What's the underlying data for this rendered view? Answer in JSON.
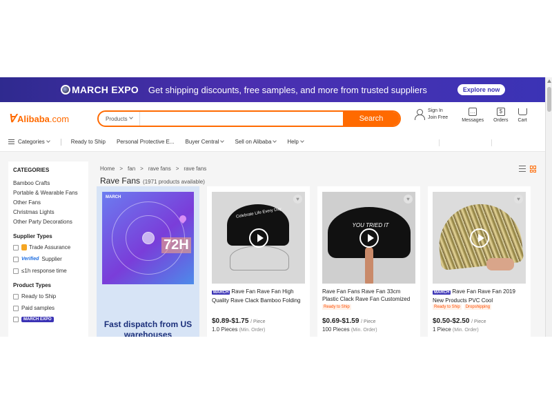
{
  "banner": {
    "logo_text": "MARCH EXPO",
    "message": "Get shipping discounts, free samples, and more from trusted suppliers",
    "cta": "Explore now"
  },
  "header": {
    "brand_name": "Alibaba",
    "brand_domain": ".com",
    "search": {
      "category": "Products",
      "value": "",
      "button": "Search"
    },
    "signin": {
      "line1": "Sign In",
      "line2": "Join Free"
    },
    "items": [
      {
        "label": "Messages",
        "icon": "message-icon"
      },
      {
        "label": "Orders",
        "icon": "orders-icon"
      },
      {
        "label": "Cart",
        "icon": "cart-icon"
      }
    ]
  },
  "nav": {
    "categories": "Categories",
    "items": [
      "Ready to Ship",
      "Personal Protective E...",
      "Buyer Central",
      "Sell on Alibaba",
      "Help"
    ]
  },
  "sidebar": {
    "categories_title": "CATEGORIES",
    "categories": [
      "Bamboo Crafts",
      "Portable & Wearable Fans",
      "Other Fans",
      "Christmas Lights",
      "Other Party Decorations"
    ],
    "supplier_types_title": "Supplier Types",
    "supplier_types": [
      "Trade Assurance",
      "Supplier",
      "≤1h response time"
    ],
    "verified_label": "Verified",
    "product_types_title": "Product Types",
    "product_types": [
      "Ready to Ship",
      "Paid samples"
    ],
    "march_expo_badge": "MARCH EXPO"
  },
  "breadcrumb": [
    "Home",
    ">",
    "fan",
    ">",
    "rave fans",
    ">",
    "rave fans"
  ],
  "results": {
    "title": "Rave Fans",
    "count": "(1971 products available)"
  },
  "promo": {
    "badge": "MARCH",
    "hours": "72H",
    "text": "Fast dispatch from US warehouses"
  },
  "products": [
    {
      "badge": "MARCH",
      "title": "Rave Fan Rave Fan High Quality Rave Clack Bamboo Folding",
      "tags": [],
      "price": "$0.89-$1.75",
      "unit": "/ Piece",
      "moq": "1.0 Pieces",
      "moq_note": "(Min. Order)",
      "image_text": "Celebrate Life Every Day"
    },
    {
      "badge": "",
      "title": "Rave Fan Fans Rave Fan 33cm Plastic Clack Rave Fan Customized",
      "tags": [
        "Ready to Ship"
      ],
      "price": "$0.69-$1.59",
      "unit": "/ Piece",
      "moq": "100 Pieces",
      "moq_note": "(Min. Order)",
      "image_text": "YOU TRIED IT"
    },
    {
      "badge": "MARCH",
      "title": "Rave Fan Rave Fan 2019 New Products PVC Cool",
      "tags": [
        "Ready to Ship",
        "Dropshipping"
      ],
      "price": "$0.50-$2.50",
      "unit": "/ Piece",
      "moq": "1 Piece",
      "moq_note": "(Min. Order)",
      "image_text": ""
    }
  ],
  "colors": {
    "accent": "#ff6a00",
    "banner": "#3b33b5",
    "tag": "#ff4d00"
  }
}
